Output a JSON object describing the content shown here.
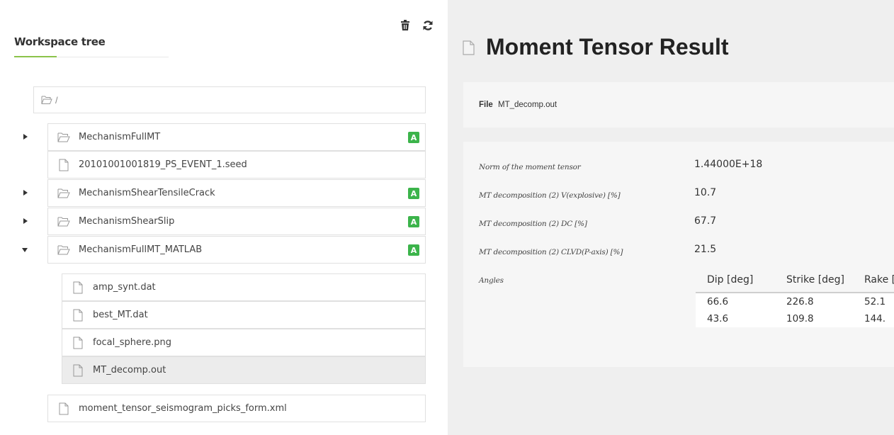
{
  "workspace": {
    "title": "Workspace tree",
    "toolbar": {
      "delete_icon": "trash-icon",
      "refresh_icon": "refresh-icon"
    },
    "root": {
      "path": "/"
    },
    "items": [
      {
        "name": "MechanismFullMT",
        "type": "folder",
        "expanded": false,
        "badge": "A"
      },
      {
        "name": "20101001001819_PS_EVENT_1.seed",
        "type": "file"
      },
      {
        "name": "MechanismShearTensileCrack",
        "type": "folder",
        "expanded": false,
        "badge": "A"
      },
      {
        "name": "MechanismShearSlip",
        "type": "folder",
        "expanded": false,
        "badge": "A"
      },
      {
        "name": "MechanismFullMT_MATLAB",
        "type": "folder",
        "expanded": true,
        "badge": "A",
        "children": [
          {
            "name": "amp_synt.dat",
            "type": "file"
          },
          {
            "name": "best_MT.dat",
            "type": "file"
          },
          {
            "name": "focal_sphere.png",
            "type": "file"
          },
          {
            "name": "MT_decomp.out",
            "type": "file",
            "selected": true
          }
        ]
      },
      {
        "name": "moment_tensor_seismogram_picks_form.xml",
        "type": "file"
      }
    ]
  },
  "result": {
    "title": "Moment Tensor Result",
    "file_label": "File",
    "file_name": "MT_decomp.out",
    "rows": [
      {
        "label": "Norm of the moment tensor",
        "value": "1.44000E+18"
      },
      {
        "label": "MT decomposition (2) V(explosive) [%]",
        "value": "10.7"
      },
      {
        "label": "MT decomposition (2) DC [%]",
        "value": "67.7"
      },
      {
        "label": "MT decomposition (2) CLVD(P-axis) [%]",
        "value": "21.5"
      }
    ],
    "angles_label": "Angles",
    "angles": {
      "headers": [
        "Dip [deg]",
        "Strike [deg]",
        "Rake [deg]"
      ],
      "rows": [
        [
          "66.6",
          "226.8",
          "52.1"
        ],
        [
          "43.6",
          "109.8",
          "144."
        ]
      ]
    }
  },
  "colors": {
    "badge_green": "#3cb44b",
    "accent_green": "#8bc34a",
    "right_panel_bg": "#efefef",
    "selected_row_bg": "#ececec"
  }
}
